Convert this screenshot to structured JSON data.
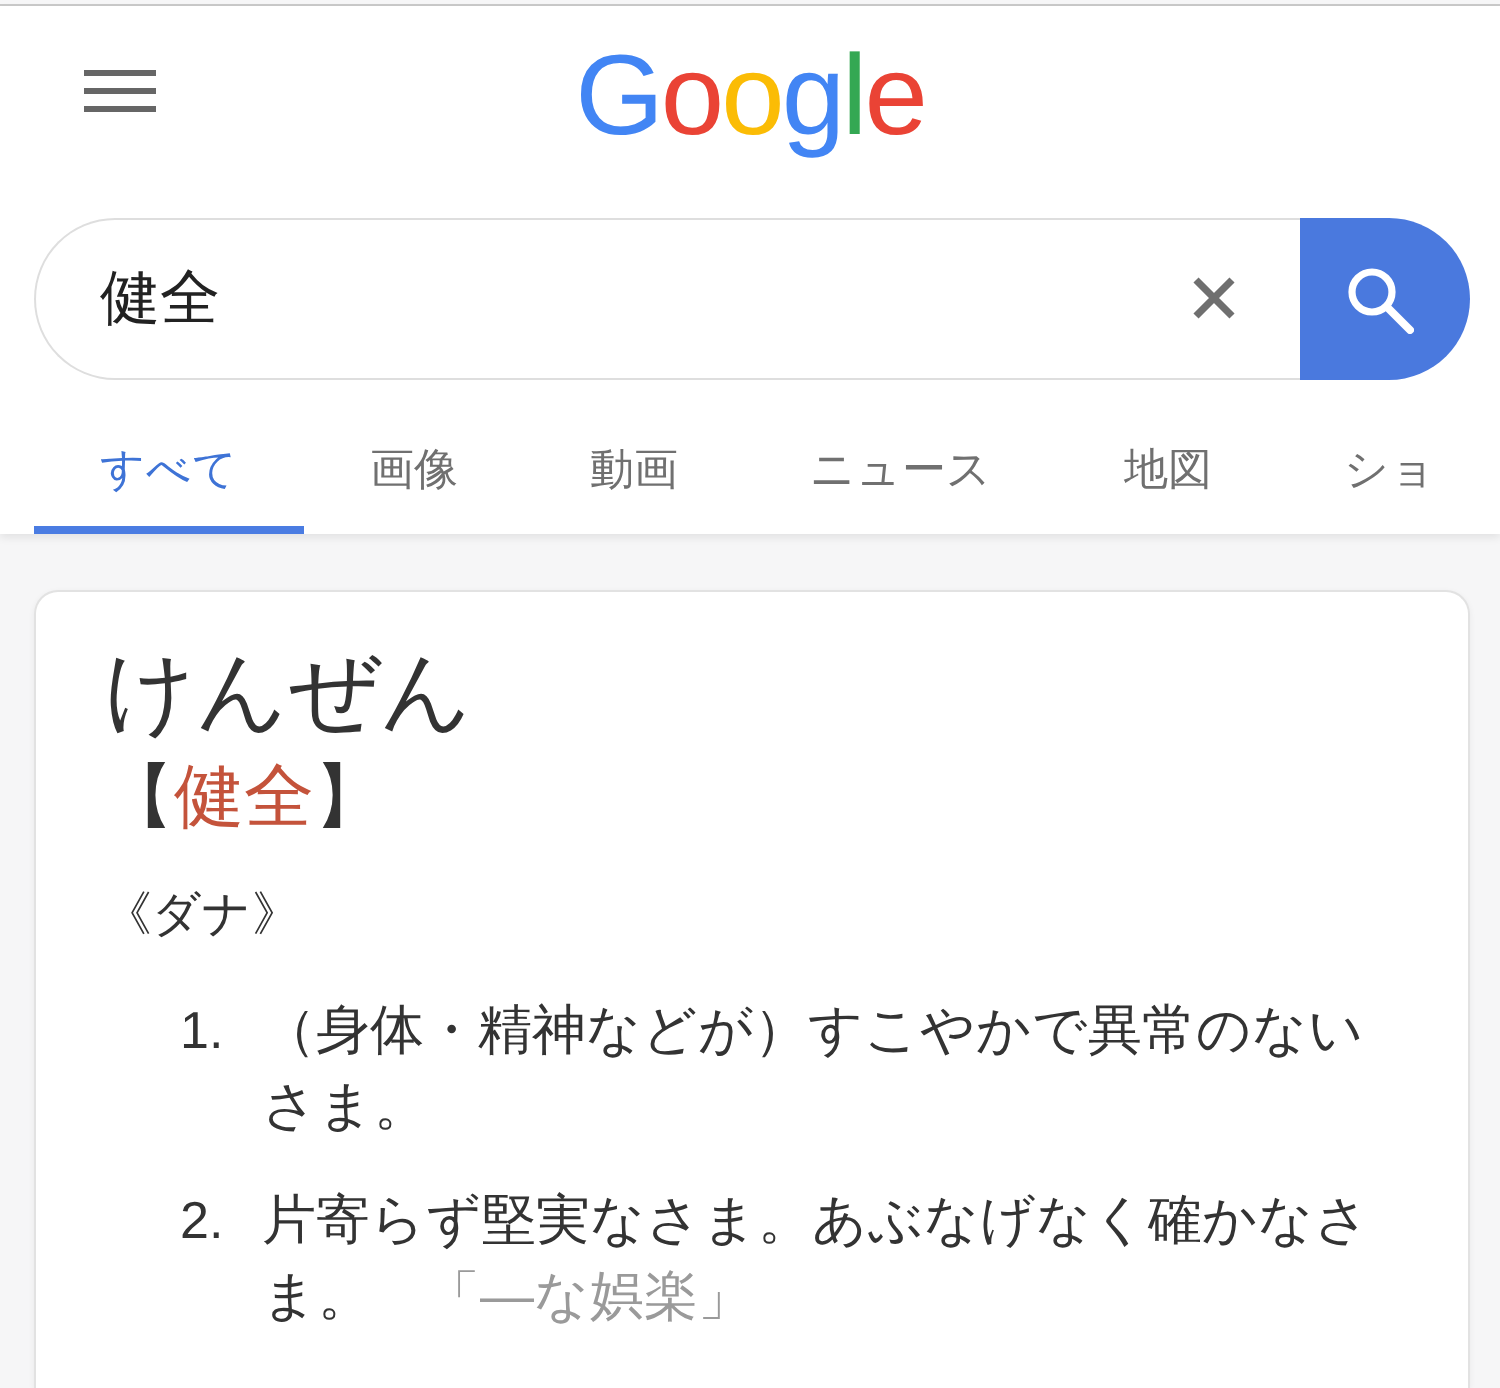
{
  "header": {
    "logo": "Google"
  },
  "search": {
    "value": "健全"
  },
  "tabs": [
    {
      "label": "すべて",
      "selected": true
    },
    {
      "label": "画像",
      "selected": false
    },
    {
      "label": "動画",
      "selected": false
    },
    {
      "label": "ニュース",
      "selected": false
    },
    {
      "label": "地図",
      "selected": false
    },
    {
      "label": "ショ",
      "selected": false
    }
  ],
  "result": {
    "reading": "けんぜん",
    "headword": [
      {
        "kind": "bracket",
        "text": "【"
      },
      {
        "kind": "word",
        "text": "健全"
      },
      {
        "kind": "bracket",
        "text": "】"
      }
    ],
    "part_of_speech": "《ダナ》",
    "definitions": [
      {
        "number": "1.",
        "text": "（身体・精神などが）すこやかで異常のないさま。"
      },
      {
        "number": "2.",
        "text": "片寄らず堅実なさま。あぶなげなく確かなさま。",
        "example": "「―な娯楽」"
      }
    ]
  }
}
